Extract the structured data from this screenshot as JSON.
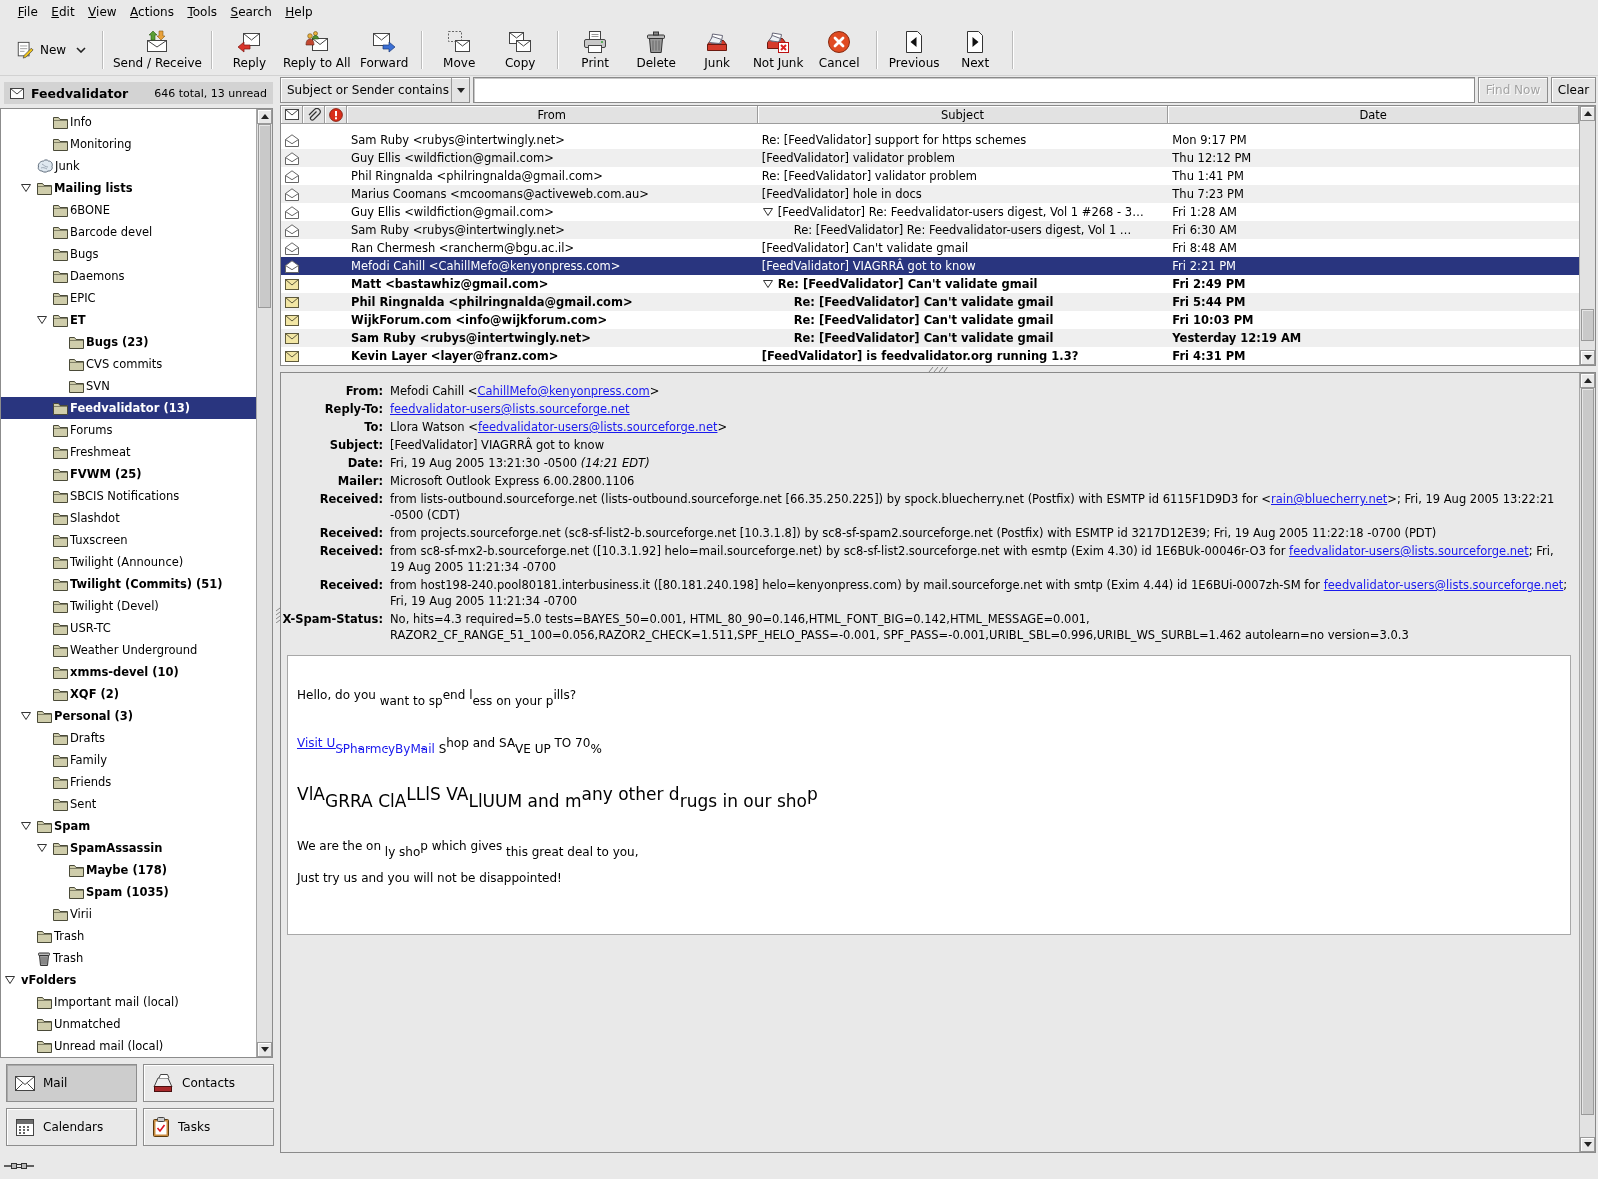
{
  "menu": [
    "File",
    "Edit",
    "View",
    "Actions",
    "Tools",
    "Search",
    "Help"
  ],
  "toolbar": {
    "groups": [
      [
        {
          "label": "New",
          "kind": "compose",
          "dropdown": true
        }
      ],
      [
        {
          "label": "Send / Receive",
          "kind": "sendreceive",
          "dropdown": false
        }
      ],
      [
        {
          "label": "Reply",
          "kind": "reply",
          "dropdown": false
        },
        {
          "label": "Reply to All",
          "kind": "replyall",
          "dropdown": false
        },
        {
          "label": "Forward",
          "kind": "forward",
          "dropdown": false
        }
      ],
      [
        {
          "label": "Move",
          "kind": "move",
          "dropdown": false
        },
        {
          "label": "Copy",
          "kind": "copy",
          "dropdown": false
        }
      ],
      [
        {
          "label": "Print",
          "kind": "print",
          "dropdown": false
        },
        {
          "label": "Delete",
          "kind": "delete",
          "dropdown": false
        },
        {
          "label": "Junk",
          "kind": "junk",
          "dropdown": false
        },
        {
          "label": "Not Junk",
          "kind": "notjunk",
          "dropdown": false
        },
        {
          "label": "Cancel",
          "kind": "cancel",
          "dropdown": false
        }
      ],
      [
        {
          "label": "Previous",
          "kind": "previous",
          "dropdown": false
        },
        {
          "label": "Next",
          "kind": "next",
          "dropdown": false
        }
      ]
    ]
  },
  "folder_header": {
    "title": "Feedvalidator",
    "summary": "646 total, 13 unread"
  },
  "folders": [
    {
      "children": [
        {
          "children": [
            {
              "label": "Info",
              "kind": "folder",
              "unread": false,
              "selected": false
            },
            {
              "label": "Monitoring",
              "kind": "folder",
              "unread": false,
              "selected": false
            }
          ]
        },
        {
          "label": "Junk",
          "kind": "junk",
          "unread": false,
          "selected": false
        },
        {
          "label": "Mailing lists",
          "kind": "folder",
          "unread": true,
          "selected": false,
          "expanded": true,
          "children": [
            {
              "label": "6BONE",
              "kind": "folder",
              "unread": false,
              "selected": false
            },
            {
              "label": "Barcode devel",
              "kind": "folder",
              "unread": false,
              "selected": false
            },
            {
              "label": "Bugs",
              "kind": "folder",
              "unread": false,
              "selected": false
            },
            {
              "label": "Daemons",
              "kind": "folder",
              "unread": false,
              "selected": false
            },
            {
              "label": "EPIC",
              "kind": "folder",
              "unread": false,
              "selected": false
            },
            {
              "label": "ET",
              "kind": "folder",
              "unread": true,
              "selected": false,
              "expanded": true,
              "children": [
                {
                  "label": "Bugs (23)",
                  "kind": "folder",
                  "unread": true,
                  "selected": false
                },
                {
                  "label": "CVS commits",
                  "kind": "folder",
                  "unread": false,
                  "selected": false
                },
                {
                  "label": "SVN",
                  "kind": "folder",
                  "unread": false,
                  "selected": false
                }
              ]
            },
            {
              "label": "Feedvalidator (13)",
              "kind": "folder",
              "unread": true,
              "selected": true
            },
            {
              "label": "Forums",
              "kind": "folder",
              "unread": false,
              "selected": false
            },
            {
              "label": "Freshmeat",
              "kind": "folder",
              "unread": false,
              "selected": false
            },
            {
              "label": "FVWM (25)",
              "kind": "folder",
              "unread": true,
              "selected": false
            },
            {
              "label": "SBCIS Notifications",
              "kind": "folder",
              "unread": false,
              "selected": false
            },
            {
              "label": "Slashdot",
              "kind": "folder",
              "unread": false,
              "selected": false
            },
            {
              "label": "Tuxscreen",
              "kind": "folder",
              "unread": false,
              "selected": false
            },
            {
              "label": "Twilight (Announce)",
              "kind": "folder",
              "unread": false,
              "selected": false
            },
            {
              "label": "Twilight (Commits) (51)",
              "kind": "folder",
              "unread": true,
              "selected": false
            },
            {
              "label": "Twilight (Devel)",
              "kind": "folder",
              "unread": false,
              "selected": false
            },
            {
              "label": "USR-TC",
              "kind": "folder",
              "unread": false,
              "selected": false
            },
            {
              "label": "Weather Underground",
              "kind": "folder",
              "unread": false,
              "selected": false
            },
            {
              "label": "xmms-devel (10)",
              "kind": "folder",
              "unread": true,
              "selected": false
            },
            {
              "label": "XQF (2)",
              "kind": "folder",
              "unread": true,
              "selected": false
            }
          ]
        },
        {
          "label": "Personal (3)",
          "kind": "folder",
          "unread": true,
          "selected": false,
          "expanded": true,
          "children": [
            {
              "label": "Drafts",
              "kind": "folder",
              "unread": false,
              "selected": false
            },
            {
              "label": "Family",
              "kind": "folder",
              "unread": false,
              "selected": false
            },
            {
              "label": "Friends",
              "kind": "folder",
              "unread": false,
              "selected": false
            },
            {
              "label": "Sent",
              "kind": "folder",
              "unread": false,
              "selected": false
            }
          ]
        },
        {
          "label": "Spam",
          "kind": "folder",
          "unread": true,
          "selected": false,
          "expanded": true,
          "children": [
            {
              "label": "SpamAssassin",
              "kind": "folder",
              "unread": true,
              "selected": false,
              "expanded": true,
              "children": [
                {
                  "label": "Maybe (178)",
                  "kind": "folder",
                  "unread": true,
                  "selected": false
                },
                {
                  "label": "Spam (1035)",
                  "kind": "folder",
                  "unread": true,
                  "selected": false
                }
              ]
            },
            {
              "label": "Virii",
              "kind": "folder",
              "unread": false,
              "selected": false
            }
          ]
        },
        {
          "label": "Trash",
          "kind": "folder",
          "unread": false,
          "selected": false
        },
        {
          "label": "Trash",
          "kind": "trash",
          "unread": false,
          "selected": false
        }
      ]
    },
    {
      "label": "vFolders",
      "unread": true,
      "selected": false,
      "expanded": true,
      "children": [
        {
          "label": "Important mail (local)",
          "kind": "folder",
          "unread": false,
          "selected": false
        },
        {
          "label": "Unmatched",
          "kind": "folder",
          "unread": false,
          "selected": false
        },
        {
          "label": "Unread mail (local)",
          "kind": "folder",
          "unread": false,
          "selected": false
        }
      ]
    }
  ],
  "switcher": [
    {
      "label": "Mail",
      "kind": "mail",
      "selected": true
    },
    {
      "label": "Contacts",
      "kind": "contacts",
      "selected": false
    },
    {
      "label": "Calendars",
      "kind": "calendars",
      "selected": false
    },
    {
      "label": "Tasks",
      "kind": "tasks",
      "selected": false
    }
  ],
  "search_bar": {
    "scope": "Subject or Sender contains",
    "buttons": [
      {
        "label": "Find Now",
        "disabled": true
      },
      {
        "label": "Clear",
        "disabled": false
      }
    ]
  },
  "message_list": {
    "columns": [
      {
        "kind": "status"
      },
      {
        "kind": "attachment"
      },
      {
        "kind": "priority"
      },
      {
        "kind": "text",
        "label": "From"
      },
      {
        "kind": "text",
        "label": "Subject"
      },
      {
        "kind": "text",
        "label": "Date"
      }
    ],
    "messages": [
      {
        "from": "Sam Ruby <rubys@intertwingly.net>",
        "subject": "Re: [FeedValidator] support for https schemes",
        "date": "Mon 9:17 PM",
        "unread": false,
        "selected": false
      },
      {
        "from": "Guy Ellis <wildfiction@gmail.com>",
        "subject": "[FeedValidator] validator problem",
        "date": "Thu 12:12 PM",
        "unread": false,
        "selected": false
      },
      {
        "from": "Phil Ringnalda <philringnalda@gmail.com>",
        "subject": "Re: [FeedValidator] validator problem",
        "date": "Thu 1:41 PM",
        "unread": false,
        "selected": false
      },
      {
        "from": "Marius Coomans <mcoomans@activeweb.com.au>",
        "subject": "[FeedValidator] hole in docs",
        "date": "Thu 7:23 PM",
        "unread": false,
        "selected": false
      },
      {
        "from": "Guy Ellis <wildfiction@gmail.com>",
        "subject": "[FeedValidator] Re: Feedvalidator-users digest, Vol 1 #268 - 3…",
        "date": "Fri 1:28 AM",
        "unread": false,
        "selected": false,
        "expanded": true,
        "children": [
          {
            "from": "Sam Ruby <rubys@intertwingly.net>",
            "subject": "Re: [FeedValidator] Re: Feedvalidator-users digest, Vol 1 …",
            "date": "Fri 6:30 AM",
            "unread": false,
            "selected": false
          }
        ]
      },
      {
        "from": "Ran Chermesh <rancherm@bgu.ac.il>",
        "subject": "[FeedValidator] Can't validate gmail",
        "date": "Fri 8:48 AM",
        "unread": false,
        "selected": false
      },
      {
        "from": "Mefodi Cahill <CahillMefo@kenyonpress.com>",
        "subject": "[FeedValidator] VIAGRRÂ got to know",
        "date": "Fri 2:21 PM",
        "unread": false,
        "selected": true
      },
      {
        "from": "Matt <bastawhiz@gmail.com>",
        "subject": "Re: [FeedValidator] Can't validate gmail",
        "date": "Fri 2:49 PM",
        "unread": true,
        "selected": false,
        "expanded": true,
        "children": [
          {
            "from": "Phil Ringnalda <philringnalda@gmail.com>",
            "subject": "Re: [FeedValidator] Can't validate gmail",
            "date": "Fri 5:44 PM",
            "unread": true,
            "selected": false
          },
          {
            "from": "WijkForum.com <info@wijkforum.com>",
            "subject": "Re: [FeedValidator] Can't validate gmail",
            "date": "Fri 10:03 PM",
            "unread": true,
            "selected": false
          },
          {
            "from": "Sam Ruby <rubys@intertwingly.net>",
            "subject": "Re: [FeedValidator] Can't validate gmail",
            "date": "Yesterday 12:19 AM",
            "unread": true,
            "selected": false
          }
        ]
      },
      {
        "from": "Kevin Layer <layer@franz.com>",
        "subject": "[FeedValidator] is feedvalidator.org running 1.3?",
        "date": "Fri 4:31 PM",
        "unread": true,
        "selected": false
      }
    ]
  },
  "preview": {
    "headers": [
      {
        "label": "From:",
        "parts": [
          {
            "kind": "text",
            "text": "Mefodi Cahill <"
          },
          {
            "kind": "link",
            "text": "CahillMefo@kenyonpress.com"
          },
          {
            "kind": "text",
            "text": ">"
          }
        ]
      },
      {
        "label": "Reply-To:",
        "parts": [
          {
            "kind": "link",
            "text": "feedvalidator-users@lists.sourceforge.net"
          }
        ]
      },
      {
        "label": "To:",
        "parts": [
          {
            "kind": "text",
            "text": "Llora Watson <"
          },
          {
            "kind": "link",
            "text": "feedvalidator-users@lists.sourceforge.net"
          },
          {
            "kind": "text",
            "text": ">"
          }
        ]
      },
      {
        "label": "Subject:",
        "parts": [
          {
            "kind": "text",
            "text": "[FeedValidator] VIAGRRÂ got to know"
          }
        ]
      },
      {
        "label": "Date:",
        "parts": [
          {
            "kind": "text",
            "text": "Fri, 19 Aug 2005 13:21:30 -0500  *(14:21 EDT)*"
          }
        ]
      },
      {
        "label": "Mailer:",
        "parts": [
          {
            "kind": "text",
            "text": "Microsoft Outlook Express 6.00.2800.1106"
          }
        ]
      },
      {
        "label": "Received:",
        "parts": [
          {
            "kind": "text",
            "text": "from lists-outbound.sourceforge.net (lists-outbound.sourceforge.net [66.35.250.225]) by spock.bluecherry.net (Postfix) with ESMTP id 6115F1D9D3 for <"
          },
          {
            "kind": "link",
            "text": "rain@bluecherry.net"
          },
          {
            "kind": "text",
            "text": ">; Fri, 19 Aug 2005 13:22:21 -0500 (CDT)"
          }
        ]
      },
      {
        "label": "Received:",
        "parts": [
          {
            "kind": "text",
            "text": "from projects.sourceforge.net (sc8-sf-list2-b.sourceforge.net [10.3.1.8]) by sc8-sf-spam2.sourceforge.net (Postfix) with ESMTP id 3217D12E39; Fri, 19 Aug 2005 11:22:18 -0700 (PDT)"
          }
        ]
      },
      {
        "label": "Received:",
        "parts": [
          {
            "kind": "text",
            "text": "from sc8-sf-mx2-b.sourceforge.net ([10.3.1.92] helo=mail.sourceforge.net) by sc8-sf-list2.sourceforge.net with esmtp (Exim 4.30) id 1E6BUk-00046r-O3 for "
          },
          {
            "kind": "link",
            "text": "feedvalidator-users@lists.sourceforge.net"
          },
          {
            "kind": "text",
            "text": "; Fri, 19 Aug 2005 11:21:34 -0700"
          }
        ]
      },
      {
        "label": "Received:",
        "parts": [
          {
            "kind": "text",
            "text": "from host198-240.pool80181.interbusiness.it ([80.181.240.198] helo=kenyonpress.com) by mail.sourceforge.net with smtp (Exim 4.44) id 1E6BUi-0007zh-SM for "
          },
          {
            "kind": "link",
            "text": "feedvalidator-users@lists.sourceforge.net"
          },
          {
            "kind": "text",
            "text": "; Fri, 19 Aug 2005 11:21:34 -0700"
          }
        ]
      },
      {
        "label": "X-Spam-Status:",
        "parts": [
          {
            "kind": "text",
            "text": "No, hits=4.3 required=5.0 tests=BAYES_50=0.001, HTML_80_90=0.146,HTML_FONT_BIG=0.142,HTML_MESSAGE=0.001, RAZOR2_CF_RANGE_51_100=0.056,RAZOR2_CHECK=1.511,SPF_HELO_PASS=-0.001, SPF_PASS=-0.001,URIBL_SBL=0.996,URIBL_WS_SURBL=1.462 autolearn=no  version=3.0.3"
          }
        ]
      }
    ],
    "body": [
      {
        "kind": "text",
        "text": "Hello, do you $_{want to sp}$end l$_{ess on your p}$ills?"
      },
      {
        "kind": "link",
        "link": "Visit U$_{SPharmcyByMail}$",
        "text": " $_{S}$hop and SA$_{VE UP}$ TO 70$_{%}$"
      },
      {
        "kind": "big",
        "text": "VlA$_{GRRA ClA}$LLlS VA$_{LlUUM and m}$any other d$_{rugs in our sho}$p"
      },
      {
        "kind": "text",
        "text": "We are the on $_{ly sho}$p which gives $_{this great deal to you,}$"
      },
      {
        "kind": "text",
        "text": "Just try us and you will not be disappointed!"
      }
    ]
  }
}
